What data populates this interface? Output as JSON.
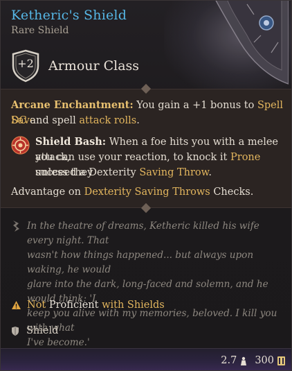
{
  "item": {
    "name": "Ketheric's Shield",
    "rarity": "Rare Shield",
    "name_color": "#56b7e6"
  },
  "armour_class": {
    "value": "+2",
    "label": "Armour Class",
    "icon": "shield-outline-icon"
  },
  "effects": {
    "arcane_name": "Arcane Enchantment:",
    "arcane_text_1": " You gain a +1 bonus to ",
    "arcane_link_1": "Spell Save",
    "arcane_link_2": "DC",
    "arcane_text_2": " and spell ",
    "arcane_link_3": "attack rolls",
    "arcane_text_3": ".",
    "bash_icon": "shield-bash-icon",
    "bash_name": "Shield Bash:",
    "bash_text_1": " When a foe hits you with a melee attack,",
    "bash_text_2": "you can use your reaction, to knock it ",
    "bash_link_prone": "Prone",
    "bash_text_3": " unless they",
    "bash_text_4": "succeed a Dexterity ",
    "bash_link_saving": "Saving Throw",
    "bash_text_5": ".",
    "adv_text_1": "Advantage on ",
    "adv_link": "Dexterity Saving Throws",
    "adv_text_2": " Checks."
  },
  "lore": {
    "icon": "quill-icon",
    "lines": [
      "In the theatre of dreams, Ketheric killed his wife every night. That",
      "wasn't how things happened... but always upon waking, he would",
      "glare into the dark, long-faced and solemn, and he would think: 'I",
      "keep you alive with my memories, beloved. I kill you with what",
      "I've become.'"
    ]
  },
  "proficiency": {
    "icon": "warning-icon",
    "not": "Not",
    "proficient": "Proficient",
    "with": "with Shields"
  },
  "type": {
    "icon": "shield-icon",
    "label": "Shield"
  },
  "footer": {
    "weight": "2.7",
    "weight_icon": "weight-icon",
    "price": "300",
    "price_icon": "gold-coin-icon"
  }
}
